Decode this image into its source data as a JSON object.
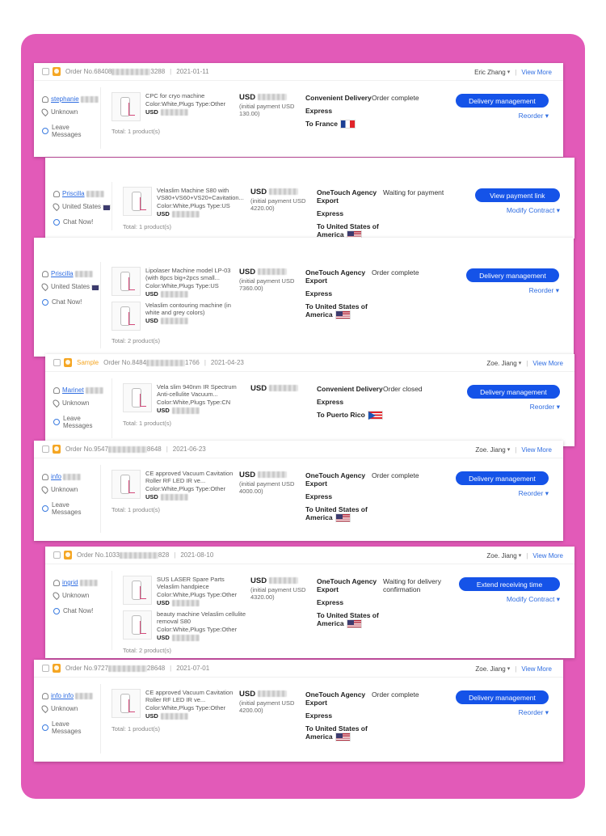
{
  "colors": {
    "frame": "#e25ab8",
    "accent": "#1553e8",
    "link": "#2f6de1",
    "warning": "#f5a623"
  },
  "common": {
    "view_more": "View More",
    "total_label": "Total:",
    "leave_messages": "Leave Messages",
    "chat_now": "Chat Now!",
    "unknown": "Unknown",
    "initial_payment_prefix": "(initial payment USD",
    "initial_payment_suffix": ")",
    "usd": "USD",
    "sample": "Sample",
    "sep": "|"
  },
  "orders": [
    {
      "order_no": "Order No.68408",
      "order_no_end": "3288",
      "date": "2021-01-11",
      "agent": "Eric Zhang",
      "buyer": "stephanie",
      "location": "Unknown",
      "contact": "Leave Messages",
      "products": [
        {
          "title": "CPC for cryo machine",
          "spec": "Color:White,Plugs Type:Other",
          "usd": "USD"
        }
      ],
      "total": "Total:  1 product(s)",
      "price_usd": "USD",
      "initial": "(initial payment USD 130.00)",
      "shipping": [
        "Convenient Delivery",
        "Express",
        "To France"
      ],
      "flag": "fr",
      "status": "Order complete",
      "button": "Delivery management",
      "link": "Reorder"
    },
    {
      "order_no": "",
      "order_no_end": "",
      "date": "",
      "agent": "",
      "buyer": "Priscilla",
      "location": "United States",
      "contact": "Chat Now!",
      "products": [
        {
          "title": "Velaslim Machine S80 with VS80+VS60+VS20+Cavitation...",
          "spec": "Color:White,Plugs Type:US",
          "usd": "USD"
        }
      ],
      "total": "Total:  1 product(s)",
      "price_usd": "USD",
      "initial": "(initial payment USD 4220.00)",
      "shipping": [
        "OneTouch Agency Export",
        "Express",
        "To United States of America"
      ],
      "flag": "us",
      "status": "Waiting for payment",
      "button": "View payment link",
      "link": "Modify Contract"
    },
    {
      "order_no": "",
      "order_no_end": "",
      "date": "",
      "agent": "",
      "buyer": "Priscilla",
      "location": "United States",
      "contact": "Chat Now!",
      "products": [
        {
          "title": "Lipolaser Machine model LP-03 (with 8pcs big+2pcs small...",
          "spec": "Color:White,Plugs Type:US",
          "usd": "USD"
        },
        {
          "title": "Velaslim contouring machine (in white and grey colors)",
          "spec": "",
          "usd": "USD"
        }
      ],
      "total": "Total:  2 product(s)",
      "price_usd": "USD",
      "initial": "(initial payment USD 7360.00)",
      "shipping": [
        "OneTouch Agency Export",
        "Express",
        "To United States of America"
      ],
      "flag": "us",
      "status": "Order complete",
      "button": "Delivery management",
      "link": "Reorder"
    },
    {
      "order_no": "Order No.8484",
      "order_no_end": "1766",
      "date": "2021-04-23",
      "agent": "Zoe. Jiang",
      "buyer": "Marinet",
      "location": "Unknown",
      "contact": "Leave Messages",
      "products": [
        {
          "title": "Vela slim 940nm IR Spectrum Anti-cellulite Vacuum...",
          "spec": "Color:White,Plugs Type:CN",
          "usd": "USD"
        }
      ],
      "total": "Total:  1 product(s)",
      "price_usd": "USD",
      "initial": "",
      "shipping": [
        "Convenient Delivery",
        "Express",
        "To Puerto Rico"
      ],
      "flag": "pr",
      "status": "Order closed",
      "button": "Delivery management",
      "link": "Reorder"
    },
    {
      "order_no": "Order No.9547",
      "order_no_end": "8648",
      "date": "2021-06-23",
      "agent": "Zoe. Jiang",
      "buyer": "info",
      "location": "Unknown",
      "contact": "Leave Messages",
      "products": [
        {
          "title": "CE approved Vacuum Cavitation Roller RF LED IR ve...",
          "spec": "Color:White,Plugs Type:Other",
          "usd": "USD"
        }
      ],
      "total": "Total:  1 product(s)",
      "price_usd": "USD",
      "initial": "(initial payment USD 4000.00)",
      "shipping": [
        "OneTouch Agency Export",
        "Express",
        "To United States of America"
      ],
      "flag": "us",
      "status": "Order complete",
      "button": "Delivery management",
      "link": "Reorder"
    },
    {
      "order_no": "Order No.1033",
      "order_no_end": "828",
      "date": "2021-08-10",
      "agent": "Zoe. Jiang",
      "buyer": "ingrid",
      "location": "Unknown",
      "contact": "Chat Now!",
      "products": [
        {
          "title": "SUS LASER Spare Parts Velaslim handpiece",
          "spec": "Color:White,Plugs Type:Other",
          "usd": "USD"
        },
        {
          "title": "beauty machine Velaslim cellulite removal S80",
          "spec": "Color:White,Plugs Type:Other",
          "usd": "USD"
        }
      ],
      "total": "Total:  2 product(s)",
      "price_usd": "USD",
      "initial": "(initial payment USD 4320.00)",
      "shipping": [
        "OneTouch Agency Export",
        "Express",
        "To United States of America"
      ],
      "flag": "us",
      "status": "Waiting for delivery confirmation",
      "button": "Extend receiving time",
      "link": "Modify Contract"
    },
    {
      "order_no": "Order No.9727",
      "order_no_end": "28648",
      "date": "2021-07-01",
      "agent": "Zoe. Jiang",
      "buyer": "info info",
      "location": "Unknown",
      "contact": "Leave Messages",
      "products": [
        {
          "title": "CE approved Vacuum Cavitation Roller RF LED IR ve...",
          "spec": "Color:White,Plugs Type:Other",
          "usd": "USD"
        }
      ],
      "total": "Total:  1 product(s)",
      "price_usd": "USD",
      "initial": "(initial payment USD 4200.00)",
      "shipping": [
        "OneTouch Agency Export",
        "Express",
        "To United States of America"
      ],
      "flag": "us",
      "status": "Order complete",
      "button": "Delivery management",
      "link": "Reorder"
    }
  ]
}
